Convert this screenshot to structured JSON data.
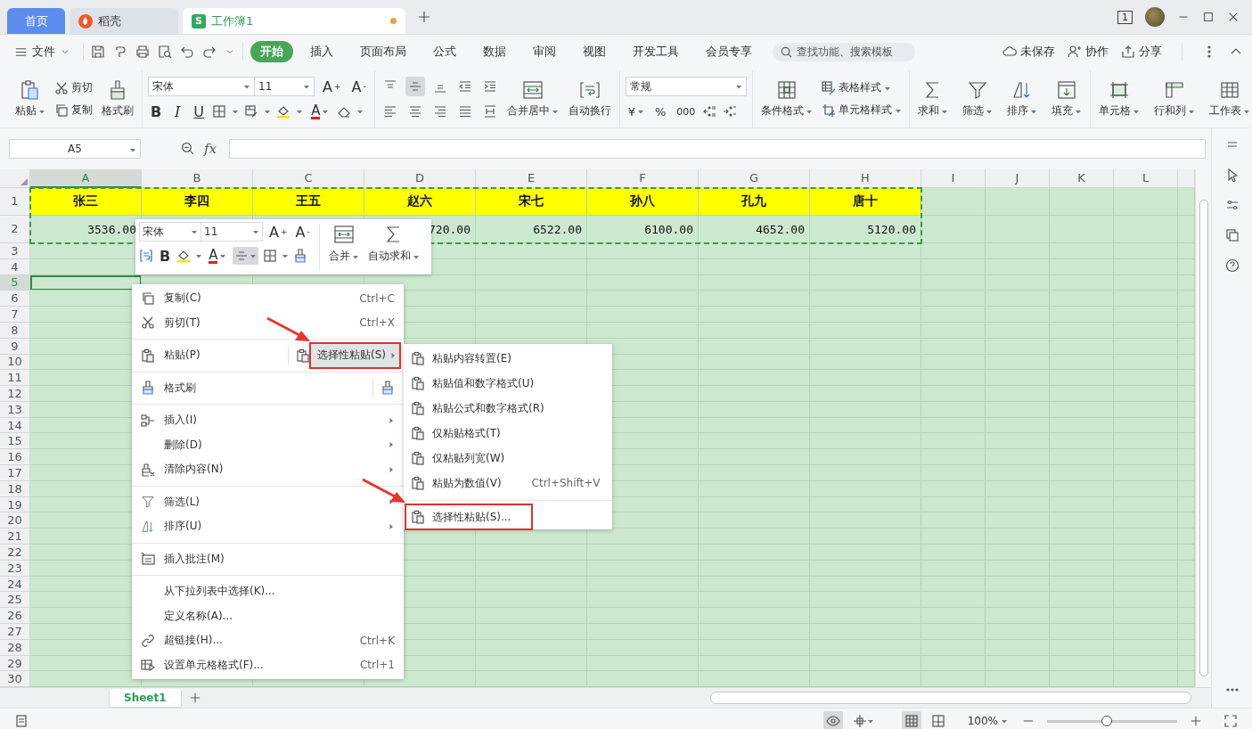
{
  "tabs": [
    {
      "label": "首页",
      "kind": "home",
      "selected": false
    },
    {
      "label": "稻壳",
      "kind": "docer",
      "selected": false
    },
    {
      "label": "工作簿1",
      "kind": "sheet",
      "badge": "S",
      "selected": true,
      "modified": true
    }
  ],
  "window": {
    "page_count": "1"
  },
  "menu_bar": {
    "file": "文件",
    "ribbon_tabs": [
      {
        "label": "开始",
        "selected": true
      },
      {
        "label": "插入",
        "selected": false
      },
      {
        "label": "页面布局",
        "selected": false
      },
      {
        "label": "公式",
        "selected": false
      },
      {
        "label": "数据",
        "selected": false
      },
      {
        "label": "审阅",
        "selected": false
      },
      {
        "label": "视图",
        "selected": false
      },
      {
        "label": "开发工具",
        "selected": false
      },
      {
        "label": "会员专享",
        "selected": false
      }
    ],
    "search": {
      "placeholder": "查找功能、搜索模板"
    },
    "actions": [
      {
        "label": "未保存",
        "kind": "cloud"
      },
      {
        "label": "协作",
        "kind": "collab"
      },
      {
        "label": "分享",
        "kind": "share"
      }
    ]
  },
  "ribbon": {
    "clipboard": [
      {
        "label": "粘贴",
        "kind": "paste",
        "dropdown": true
      },
      {
        "label": "剪切",
        "kind": "cut",
        "dropdown": false
      },
      {
        "label": "复制",
        "kind": "copy",
        "dropdown": false
      },
      {
        "label": "格式刷",
        "kind": "painter",
        "dropdown": false
      }
    ],
    "font": {
      "name": "宋体",
      "size": "11",
      "grow": "A$^{+}$",
      "shrink": "A$^{-}$",
      "bold": "B",
      "italic": "I",
      "underline": "U",
      "font_color": "A"
    },
    "alignment": [
      {
        "kind": "top",
        "selected": false
      },
      {
        "kind": "middle",
        "selected": true
      },
      {
        "kind": "bottom",
        "selected": false
      },
      {
        "kind": "outdent",
        "selected": false
      },
      {
        "kind": "indent",
        "selected": false
      },
      {
        "kind": "left",
        "selected": false
      },
      {
        "kind": "center",
        "selected": false
      },
      {
        "kind": "right",
        "selected": false
      },
      {
        "kind": "justify",
        "selected": false
      },
      {
        "kind": "distributed",
        "selected": false
      }
    ],
    "merge": {
      "label": "合并居中",
      "dropdown": true
    },
    "wrap": {
      "label": "自动换行",
      "dropdown": false
    },
    "number": {
      "format": "常规",
      "currency": "¥",
      "percent": "%",
      "thousands": "000"
    },
    "styles": [
      {
        "label": "条件格式",
        "kind": "conditional"
      },
      {
        "label": "表格样式",
        "kind": "table_style"
      },
      {
        "label": "单元格样式",
        "kind": "cell_style"
      }
    ],
    "editing": [
      {
        "label": "求和",
        "kind": "sum"
      },
      {
        "label": "筛选",
        "kind": "filter"
      },
      {
        "label": "排序",
        "kind": "sort"
      },
      {
        "label": "填充",
        "kind": "fill"
      }
    ],
    "cells": [
      {
        "label": "单元格",
        "kind": "cell"
      },
      {
        "label": "行和列",
        "kind": "rowcol"
      },
      {
        "label": "工作表",
        "kind": "worksheet"
      }
    ]
  },
  "formula_bar": {
    "name_box": "A5",
    "fx": "fx"
  },
  "sheet": {
    "columns": [
      {
        "label": "A",
        "selected": true
      },
      {
        "label": "B",
        "selected": false
      },
      {
        "label": "C",
        "selected": false
      },
      {
        "label": "D",
        "selected": false
      },
      {
        "label": "E",
        "selected": false
      },
      {
        "label": "F",
        "selected": false
      },
      {
        "label": "G",
        "selected": false
      },
      {
        "label": "H",
        "selected": false
      },
      {
        "label": "I",
        "selected": false
      },
      {
        "label": "J",
        "selected": false
      },
      {
        "label": "K",
        "selected": false
      },
      {
        "label": "L",
        "selected": false
      }
    ],
    "rows": [
      {
        "label": "1",
        "kind": "header",
        "selected": false,
        "copied": true,
        "cells": [
          "张三",
          "李四",
          "王五",
          "赵六",
          "宋七",
          "孙八",
          "孔九",
          "唐十"
        ]
      },
      {
        "label": "2",
        "kind": "data",
        "selected": false,
        "copied": true,
        "cells": [
          "3536.00",
          "",
          "",
          "720.00",
          "6522.00",
          "6100.00",
          "4652.00",
          "5120.00"
        ]
      },
      {
        "label": "3",
        "selected": false,
        "copied": false
      },
      {
        "label": "4",
        "selected": false,
        "copied": false
      },
      {
        "label": "5",
        "selected": true,
        "copied": false
      },
      {
        "label": "6",
        "selected": false,
        "copied": false
      },
      {
        "label": "7",
        "selected": false,
        "copied": false
      },
      {
        "label": "8",
        "selected": false,
        "copied": false
      },
      {
        "label": "9",
        "selected": false,
        "copied": false
      },
      {
        "label": "10",
        "selected": false,
        "copied": false
      },
      {
        "label": "11",
        "selected": false,
        "copied": false
      },
      {
        "label": "12",
        "selected": false,
        "copied": false
      },
      {
        "label": "13",
        "selected": false,
        "copied": false
      },
      {
        "label": "14",
        "selected": false,
        "copied": false
      },
      {
        "label": "15",
        "selected": false,
        "copied": false
      },
      {
        "label": "16",
        "selected": false,
        "copied": false
      },
      {
        "label": "17",
        "selected": false,
        "copied": false
      },
      {
        "label": "18",
        "selected": false,
        "copied": false
      },
      {
        "label": "19",
        "selected": false,
        "copied": false
      },
      {
        "label": "20",
        "selected": false,
        "copied": false
      },
      {
        "label": "21",
        "selected": false,
        "copied": false
      },
      {
        "label": "22",
        "selected": false,
        "copied": false
      },
      {
        "label": "23",
        "selected": false,
        "copied": false
      },
      {
        "label": "24",
        "selected": false,
        "copied": false
      },
      {
        "label": "25",
        "selected": false,
        "copied": false
      },
      {
        "label": "26",
        "selected": false,
        "copied": false
      },
      {
        "label": "27",
        "selected": false,
        "copied": false
      },
      {
        "label": "28",
        "selected": false,
        "copied": false
      },
      {
        "label": "29",
        "selected": false,
        "copied": false
      },
      {
        "label": "30",
        "selected": false,
        "copied": false
      }
    ]
  },
  "sheet_tabs": [
    {
      "label": "Sheet1",
      "selected": true
    }
  ],
  "status_bar": {
    "zoom": "100%",
    "zoom_slider": {
      "level": 0.46
    }
  },
  "mini_toolbar": {
    "font": "宋体",
    "size": "11",
    "grow": "A$^{+}$",
    "shrink": "A$^{-}$",
    "bold": "B",
    "font_color": "A",
    "align": {
      "selected": true
    },
    "merge": "合并",
    "autosum": "自动求和"
  },
  "context_menu": {
    "groups": [
      [
        {
          "label": "复制(C)",
          "shortcut": "Ctrl+C",
          "submenu": false
        },
        {
          "label": "剪切(T)",
          "shortcut": "Ctrl+X",
          "submenu": false
        }
      ],
      [
        {
          "label": "粘贴(P)",
          "kind": "paste",
          "submenu": false,
          "special": {
            "label": "选择性粘贴(S)",
            "selected": true,
            "highlighted": true
          }
        }
      ],
      [
        {
          "label": "格式刷",
          "kind": "painter",
          "submenu": false
        }
      ],
      [
        {
          "label": "插入(I)",
          "submenu": true
        },
        {
          "label": "删除(D)",
          "submenu": true
        },
        {
          "label": "清除内容(N)",
          "submenu": true
        }
      ],
      [
        {
          "label": "筛选(L)",
          "submenu": true
        },
        {
          "label": "排序(U)",
          "submenu": true
        }
      ],
      [
        {
          "label": "插入批注(M)",
          "submenu": false
        }
      ],
      [
        {
          "label": "从下拉列表中选择(K)...",
          "submenu": false
        },
        {
          "label": "定义名称(A)...",
          "submenu": false
        },
        {
          "label": "超链接(H)...",
          "shortcut": "Ctrl+K",
          "submenu": false
        },
        {
          "label": "设置单元格格式(F)...",
          "shortcut": "Ctrl+1",
          "submenu": false
        }
      ]
    ]
  },
  "paste_submenu": {
    "groups": [
      [
        {
          "label": "粘贴内容转置(E)",
          "highlighted": false
        },
        {
          "label": "粘贴值和数字格式(U)",
          "highlighted": false
        },
        {
          "label": "粘贴公式和数字格式(R)",
          "highlighted": false
        },
        {
          "label": "仅粘贴格式(T)",
          "highlighted": false
        },
        {
          "label": "仅粘贴列宽(W)",
          "highlighted": false
        },
        {
          "label": "粘贴为数值(V)",
          "shortcut": "Ctrl+Shift+V",
          "highlighted": false
        }
      ],
      [
        {
          "label": "选择性粘贴(S)...",
          "highlighted": true
        }
      ]
    ]
  }
}
